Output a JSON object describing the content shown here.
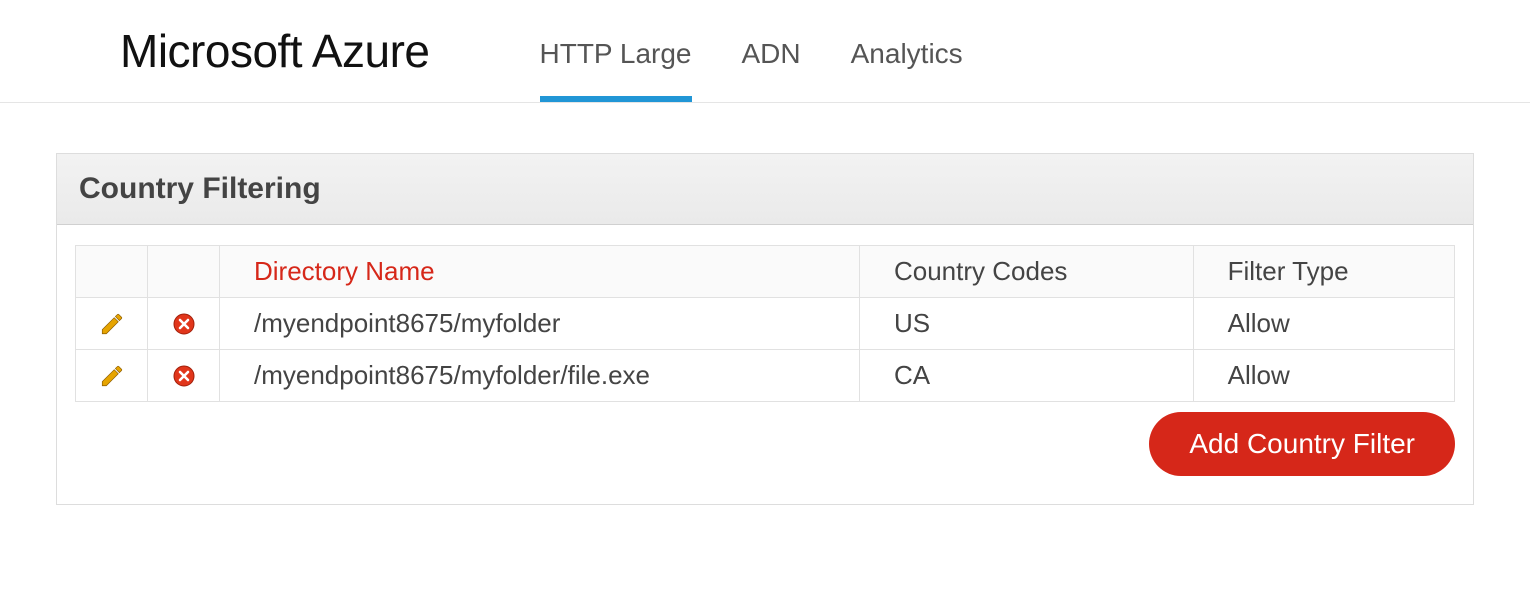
{
  "header": {
    "logo_text": "Microsoft Azure",
    "tabs": [
      {
        "label": "HTTP Large",
        "active": true
      },
      {
        "label": "ADN",
        "active": false
      },
      {
        "label": "Analytics",
        "active": false
      }
    ]
  },
  "panel": {
    "title": "Country Filtering",
    "columns": {
      "directory": "Directory Name",
      "codes": "Country Codes",
      "filter": "Filter Type"
    },
    "sort_column": "directory",
    "rows": [
      {
        "directory": "/myendpoint8675/myfolder",
        "codes": "US",
        "filter": "Allow"
      },
      {
        "directory": "/myendpoint8675/myfolder/file.exe",
        "codes": "CA",
        "filter": "Allow"
      }
    ],
    "add_button": "Add Country Filter"
  }
}
